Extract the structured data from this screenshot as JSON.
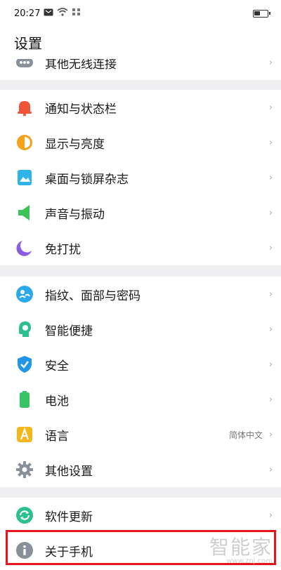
{
  "status_bar": {
    "time": "20:27",
    "battery_level": 0.45
  },
  "header": {
    "title": "设置"
  },
  "groups": [
    {
      "rows": [
        {
          "label": "其他无线连接",
          "icon": "more-dots-icon",
          "color": "#8a9099"
        }
      ]
    },
    {
      "rows": [
        {
          "label": "通知与状态栏",
          "icon": "bell-icon",
          "color": "#f0553a"
        },
        {
          "label": "显示与亮度",
          "icon": "brightness-icon",
          "color": "#f6a21b"
        },
        {
          "label": "桌面与锁屏杂志",
          "icon": "wallpaper-icon",
          "color": "#2fb4ea"
        },
        {
          "label": "声音与振动",
          "icon": "speaker-icon",
          "color": "#3cc45a"
        },
        {
          "label": "免打扰",
          "icon": "moon-icon",
          "color": "#8a5ce0"
        }
      ]
    },
    {
      "rows": [
        {
          "label": "指纹、面部与密码",
          "icon": "fingerprint-icon",
          "color": "#29a9e8"
        },
        {
          "label": "智能便捷",
          "icon": "smart-head-icon",
          "color": "#2cbf8f"
        },
        {
          "label": "安全",
          "icon": "shield-icon",
          "color": "#2196e8"
        },
        {
          "label": "电池",
          "icon": "battery-icon",
          "color": "#38c465"
        },
        {
          "label": "语言",
          "icon": "language-icon",
          "color": "#f4b61d",
          "value": "简体中文"
        },
        {
          "label": "其他设置",
          "icon": "gear-icon",
          "color": "#8a9099"
        }
      ]
    },
    {
      "rows": [
        {
          "label": "软件更新",
          "icon": "update-icon",
          "color": "#2cbf8f"
        },
        {
          "label": "关于手机",
          "icon": "info-icon",
          "color": "#8a9099"
        }
      ]
    }
  ],
  "watermark": {
    "main": "智能家",
    "sub": "www.znj.com"
  },
  "chevron": "›"
}
